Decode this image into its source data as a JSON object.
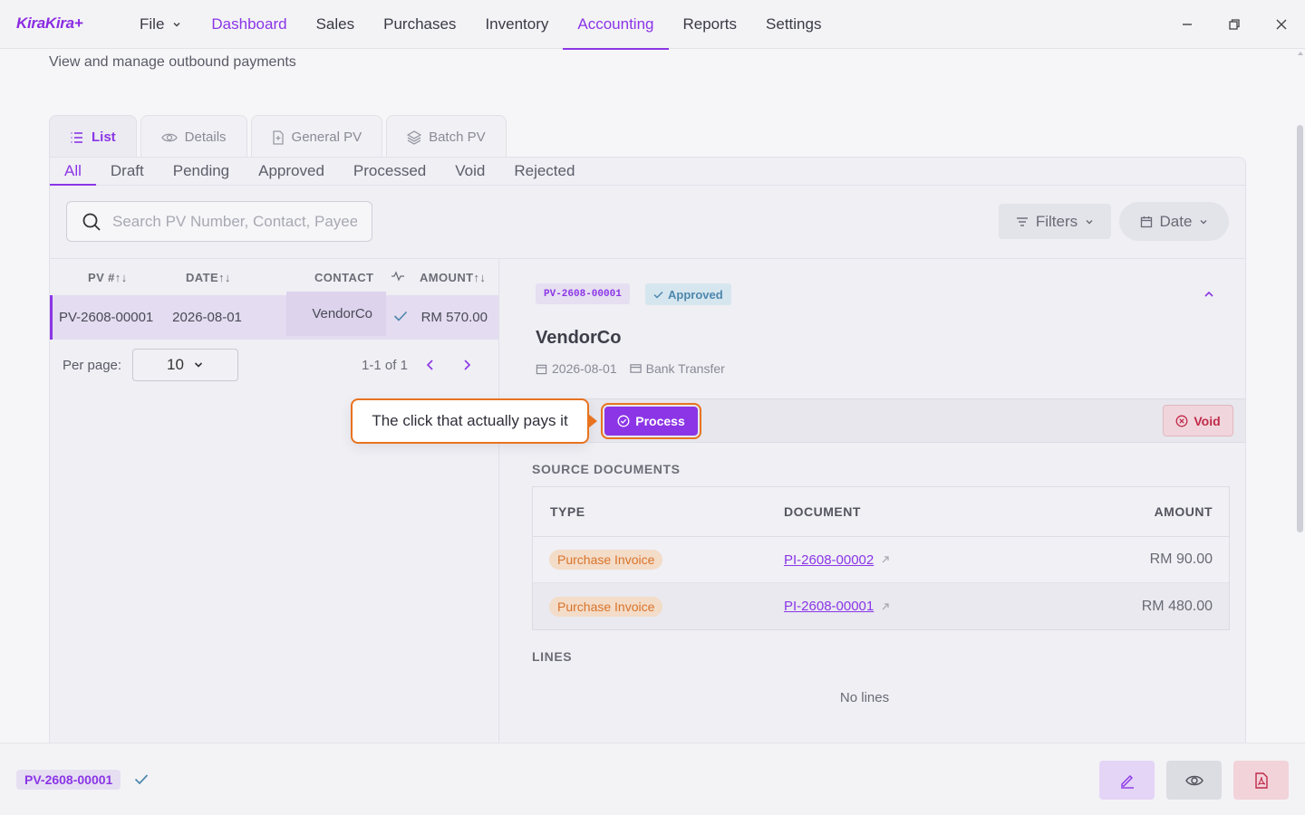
{
  "app": {
    "logo": "KiraKira+"
  },
  "menu": {
    "file": "File",
    "items": [
      "Dashboard",
      "Sales",
      "Purchases",
      "Inventory",
      "Accounting",
      "Reports",
      "Settings"
    ]
  },
  "page": {
    "subtitle": "View and manage outbound payments"
  },
  "tabs": [
    "List",
    "Details",
    "General PV",
    "Batch PV"
  ],
  "status_filters": [
    "All",
    "Draft",
    "Pending",
    "Approved",
    "Processed",
    "Void",
    "Rejected"
  ],
  "search": {
    "placeholder": "Search PV Number, Contact, Payee"
  },
  "buttons": {
    "filters": "Filters",
    "date": "Date",
    "process": "Process",
    "void": "Void"
  },
  "list_table": {
    "headers": {
      "pv": "PV #",
      "date": "DATE",
      "contact": "CONTACT",
      "amount": "AMOUNT"
    },
    "rows": [
      {
        "pv": "PV-2608-00001",
        "date": "2026-08-01",
        "contact": "VendorCo",
        "amount": "RM 570.00"
      }
    ],
    "per_page_label": "Per page:",
    "per_page_value": "10",
    "range": "1-1 of 1"
  },
  "detail": {
    "pv_number": "PV-2608-00001",
    "status": "Approved",
    "vendor": "VendorCo",
    "date": "2026-08-01",
    "method": "Bank Transfer",
    "source_docs_title": "SOURCE DOCUMENTS",
    "source_headers": {
      "type": "TYPE",
      "document": "DOCUMENT",
      "amount": "AMOUNT"
    },
    "source_rows": [
      {
        "type": "Purchase Invoice",
        "document": "PI-2608-00002",
        "amount": "RM 90.00"
      },
      {
        "type": "Purchase Invoice",
        "document": "PI-2608-00001",
        "amount": "RM 480.00"
      }
    ],
    "lines_title": "LINES",
    "no_lines": "No lines"
  },
  "callout": {
    "text": "The click that actually pays it"
  },
  "bottom": {
    "pv_number": "PV-2608-00001"
  },
  "colors": {
    "accent": "#8b35e6",
    "callout": "#e8731f",
    "void": "#c02a4a"
  }
}
